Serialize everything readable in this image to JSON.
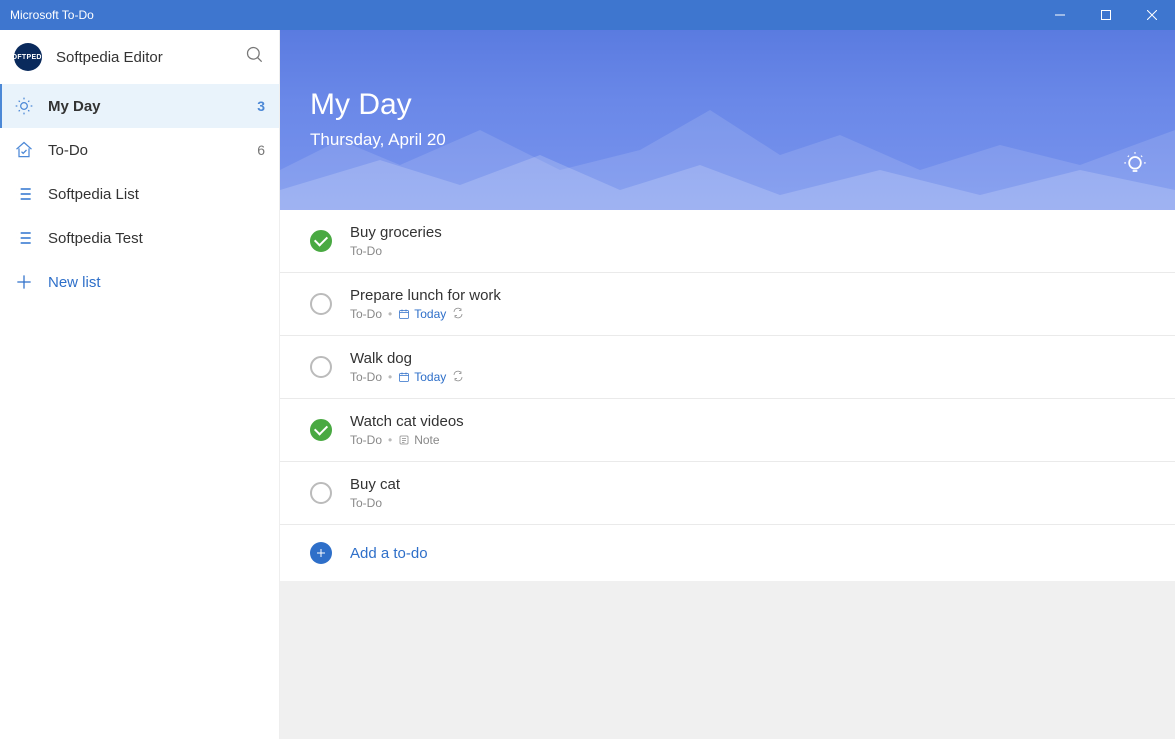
{
  "window": {
    "title": "Microsoft To-Do"
  },
  "user": {
    "name": "Softpedia Editor",
    "avatar_text": "SOFTPEDIA"
  },
  "sidebar": {
    "items": [
      {
        "label": "My Day",
        "count": "3"
      },
      {
        "label": "To-Do",
        "count": "6"
      },
      {
        "label": "Softpedia List",
        "count": ""
      },
      {
        "label": "Softpedia Test",
        "count": ""
      }
    ],
    "new_list": "New list"
  },
  "hero": {
    "title": "My Day",
    "date": "Thursday, April 20"
  },
  "tasks": [
    {
      "title": "Buy groceries",
      "list": "To-Do",
      "completed": true,
      "due": "",
      "note": "",
      "repeat": false
    },
    {
      "title": "Prepare lunch for work",
      "list": "To-Do",
      "completed": false,
      "due": "Today",
      "note": "",
      "repeat": true
    },
    {
      "title": "Walk dog",
      "list": "To-Do",
      "completed": false,
      "due": "Today",
      "note": "",
      "repeat": true
    },
    {
      "title": "Watch cat videos",
      "list": "To-Do",
      "completed": true,
      "due": "",
      "note": "Note",
      "repeat": false
    },
    {
      "title": "Buy cat",
      "list": "To-Do",
      "completed": false,
      "due": "",
      "note": "",
      "repeat": false
    }
  ],
  "add": {
    "label": "Add a to-do"
  }
}
